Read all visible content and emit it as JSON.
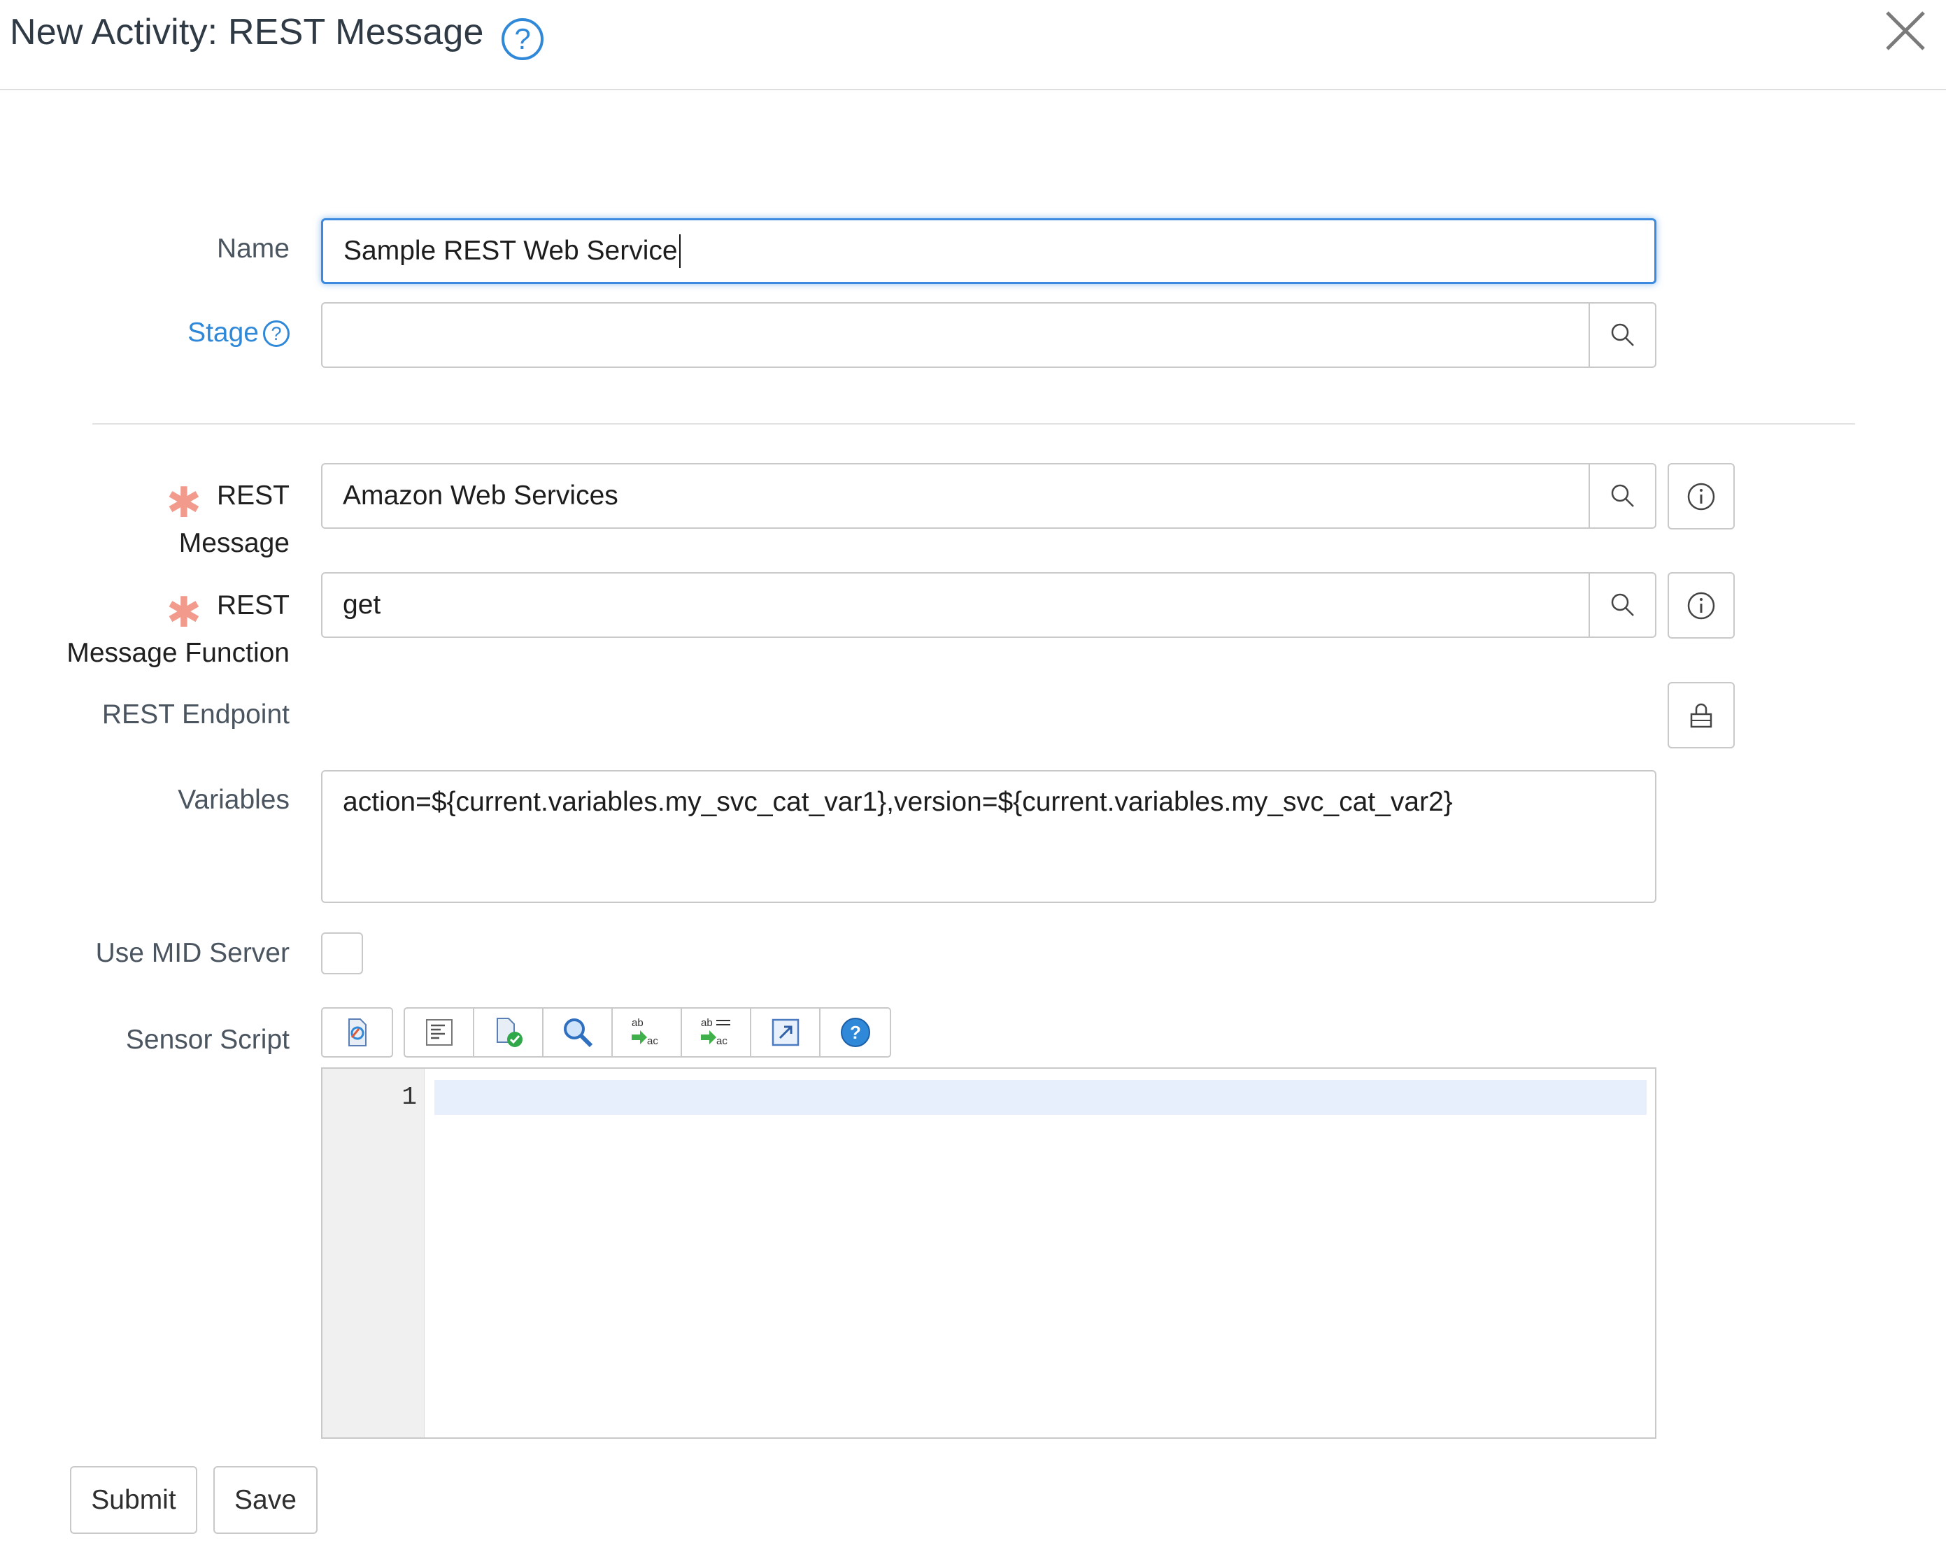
{
  "header": {
    "title": "New Activity: REST Message",
    "help_icon": "question-circle-icon",
    "close_icon": "close-icon"
  },
  "form": {
    "name": {
      "label": "Name",
      "value": "Sample REST Web Service"
    },
    "stage": {
      "label": "Stage",
      "value": "",
      "help": "?"
    },
    "rest_message": {
      "label_line1": "REST",
      "label_line2": "Message",
      "value": "Amazon Web Services",
      "required": true
    },
    "rest_message_function": {
      "label_line1": "REST",
      "label_line2": "Message Function",
      "value": "get",
      "required": true
    },
    "rest_endpoint": {
      "label": "REST Endpoint"
    },
    "variables": {
      "label": "Variables",
      "value": "action=${current.variables.my_svc_cat_var1},version=${current.variables.my_svc_cat_var2}"
    },
    "use_mid_server": {
      "label": "Use MID Server",
      "checked": false
    },
    "sensor_script": {
      "label": "Sensor Script",
      "line_number": "1"
    }
  },
  "required_marker": "✱",
  "toolbar_icons": [
    "toggle-syntax-icon",
    "format-code-icon",
    "check-syntax-icon",
    "search-icon",
    "replace-icon",
    "replace-all-icon",
    "fullscreen-icon",
    "help-icon"
  ],
  "buttons": {
    "submit": "Submit",
    "save": "Save"
  },
  "colors": {
    "link": "#2f88d8",
    "required": "#f29a8c",
    "focus": "#3b8ae0",
    "active_line": "#e6effb"
  }
}
